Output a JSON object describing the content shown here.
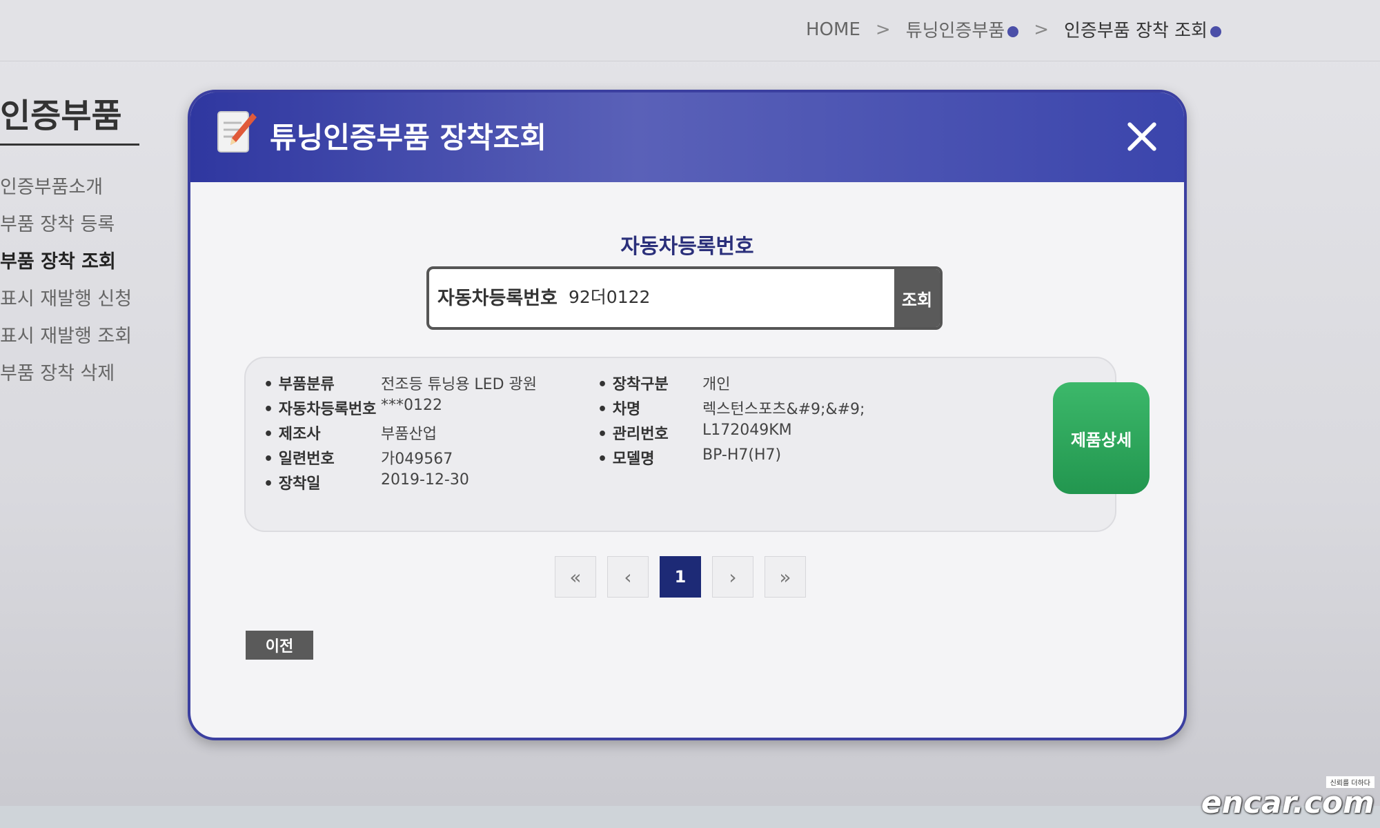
{
  "breadcrumb": {
    "home": "HOME",
    "sep": ">",
    "level1": "튜닝인증부품",
    "level2": "인증부품 장착 조회"
  },
  "sidebar": {
    "title": "인증부품",
    "items": [
      {
        "label": "인증부품소개"
      },
      {
        "label": "부품 장착 등록"
      },
      {
        "label": "부품 장착 조회"
      },
      {
        "label": "표시 재발행 신청"
      },
      {
        "label": "표시 재발행 조회"
      },
      {
        "label": "부품 장착 삭제"
      }
    ]
  },
  "modal": {
    "title": "튜닝인증부품 장착조회",
    "close_icon": "close-icon",
    "section_label": "자동차등록번호",
    "search": {
      "label": "자동차등록번호",
      "value": "92더0122",
      "button": "조회"
    },
    "result": {
      "left": [
        {
          "key": "부품분류",
          "value": "전조등 튜닝용 LED 광원"
        },
        {
          "key": "자동차등록번호",
          "value": "***0122"
        },
        {
          "key": "제조사",
          "value": "부품산업"
        },
        {
          "key": "일련번호",
          "value": "가049567"
        },
        {
          "key": "장착일",
          "value": "2019-12-30"
        }
      ],
      "right": [
        {
          "key": "장착구분",
          "value": "개인"
        },
        {
          "key": "차명",
          "value": "렉스턴스포츠&#9;&#9;"
        },
        {
          "key": "관리번호",
          "value": "L172049KM"
        },
        {
          "key": "모델명",
          "value": "BP-H7(H7)"
        }
      ],
      "detail_button": "제품상세"
    },
    "pagination": {
      "first": "«",
      "prev": "‹",
      "current": "1",
      "next": "›",
      "last": "»"
    },
    "prev_button": "이전"
  },
  "watermark": {
    "tagline": "신뢰를 더하다",
    "brand": "encar.com"
  },
  "colors": {
    "modal_header": "#3b3fa0",
    "detail_button": "#22964f",
    "page_current": "#1d2a76"
  }
}
